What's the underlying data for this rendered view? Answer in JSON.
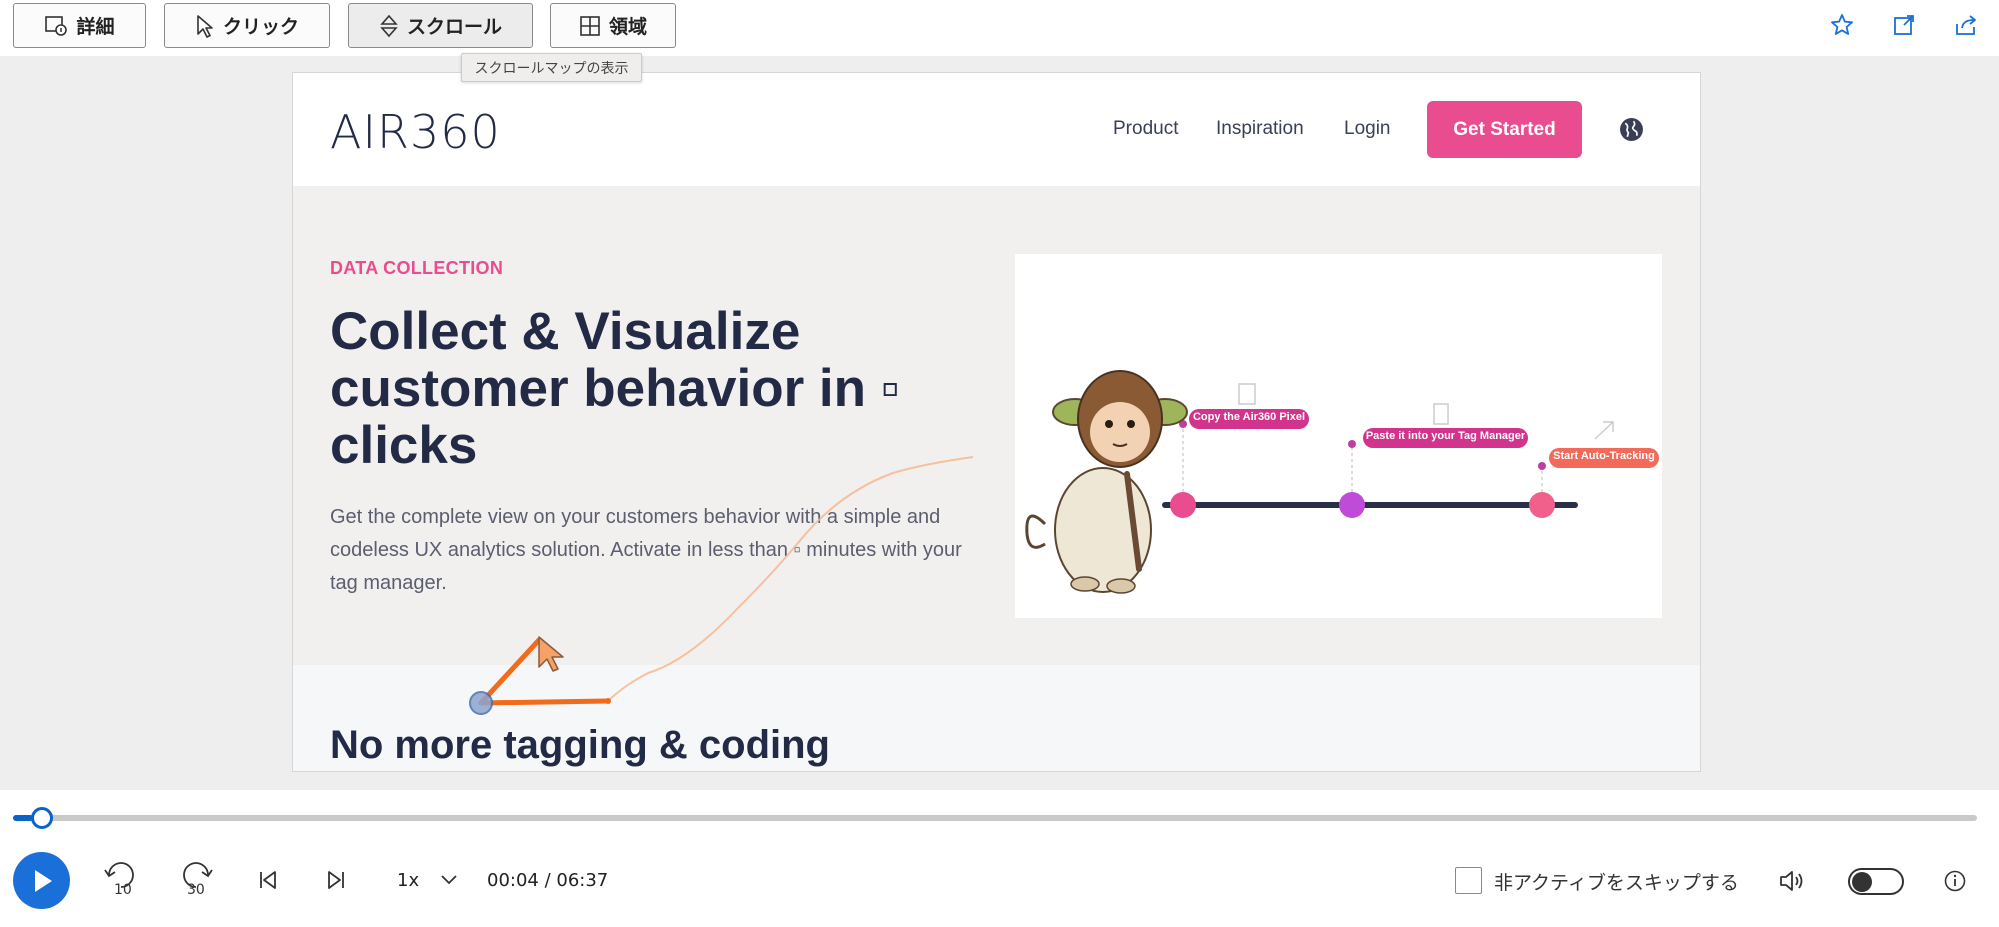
{
  "toolbar": {
    "details_label": "詳細",
    "click_label": "クリック",
    "scroll_label": "スクロール",
    "area_label": "領域",
    "scroll_tooltip": "スクロールマップの表示",
    "icons": [
      "details-icon",
      "pointer-icon",
      "scroll-icon",
      "area-grid-icon",
      "star-icon",
      "open-external-icon",
      "share-icon"
    ]
  },
  "site": {
    "logo_air": "AIR",
    "logo_num": "360",
    "nav": [
      "Product",
      "Inspiration",
      "Login"
    ],
    "cta": "Get Started",
    "eyebrow": "DATA COLLECTION",
    "headline": "Collect & Visualize customer behavior in ▫ clicks",
    "description": "Get the complete view on your customers behavior with a simple and codeless UX analytics solution. Activate in less than ▫ minutes with your tag manager.",
    "steps": [
      "Copy the Air360 Pixel",
      "Paste it into your Tag Manager",
      "Start Auto-Tracking"
    ],
    "section2_title": "No more tagging & coding"
  },
  "player": {
    "skip_back": "10",
    "skip_forward": "30",
    "speed": "1x",
    "time": "00:04 / 06:37",
    "progress": 0.01,
    "skip_inactive_label": "非アクティブをスキップする",
    "skip_inactive_checked": false
  },
  "colors": {
    "accent": "#1a6fd8",
    "brand_pink": "#e94c8f",
    "brand_navy": "#232a45",
    "trail": "#f26a1b"
  }
}
